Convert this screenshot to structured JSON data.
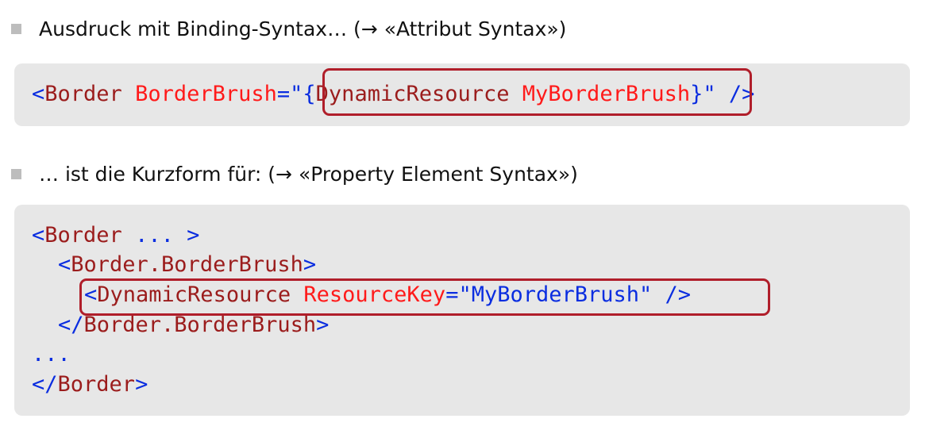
{
  "bullets": [
    {
      "text": "Ausdruck mit Binding-Syntax… (→ «Attribut Syntax»)"
    },
    {
      "text": "… ist die Kurzform für: (→ «Property Element Syntax»)"
    }
  ],
  "code1": {
    "open": "<",
    "tag": "Border",
    "attr": "BorderBrush",
    "eq": "=\"",
    "brace_open": "{",
    "ext_name": "DynamicResource",
    "ext_arg": "MyBorderBrush",
    "brace_close": "}",
    "tail": "\" />"
  },
  "code2": {
    "line1_open": "<",
    "line1_tag": "Border",
    "line1_rest": " ... >",
    "line2_open": "<",
    "line2_tag": "Border.BorderBrush",
    "line2_close": ">",
    "line3_open": "<",
    "line3_tag": "DynamicResource",
    "line3_attr": "ResourceKey",
    "line3_value": "=\"MyBorderBrush\" />",
    "line4_open": "</",
    "line4_tag": "Border.BorderBrush",
    "line4_close": ">",
    "line5": "...",
    "line6_open": "</",
    "line6_tag": "Border",
    "line6_close": ">"
  },
  "colors": {
    "markup_blue": "#0a2de0",
    "tag_darkred": "#9b1c1c",
    "attr_red": "#ff1a1a",
    "highlight_border": "#b01e2a",
    "code_bg": "#e7e7e7",
    "bullet_gray": "#bdbdbd"
  }
}
